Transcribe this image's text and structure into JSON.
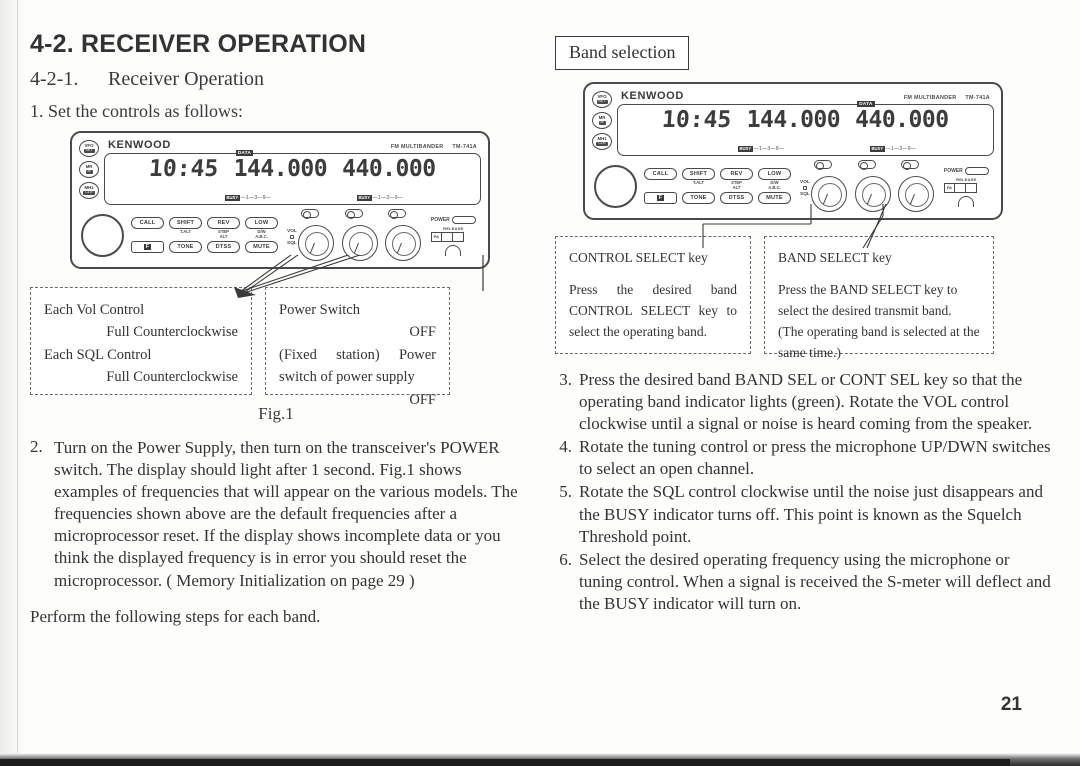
{
  "document": {
    "page_number": "21"
  },
  "left_column": {
    "section_title": "4-2. RECEIVER OPERATION",
    "subsection_number": "4-2-1.",
    "subsection_title": "Receiver Operation",
    "step1": "1. Set the controls as follows:",
    "figure_caption": "Fig.1",
    "callout_vol": {
      "line1": "Each Vol Control",
      "line2": "Full Counterclockwise",
      "line3": "Each SQL Control",
      "line4": "Full Counterclockwise"
    },
    "callout_power": {
      "line1": "Power Switch",
      "line2": "OFF",
      "line3": "(Fixed station) Power",
      "line4": "switch of power supply",
      "line5": "OFF"
    },
    "step2_number": "2.",
    "step2_text": "Turn on the Power Supply, then turn on the transceiver's POWER switch. The display should light after 1 second. Fig.1 shows examples of frequencies that will appear on the various models. The frequencies shown above are the default frequencies after a microprocessor reset.  If the display shows incomplete data or you think the displayed frequency is in error you should reset the microprocessor. ( Memory Initialization on page 29 )",
    "perform_text": "Perform the following steps for each band."
  },
  "right_column": {
    "band_selection_label": "Band selection",
    "callout_control_select": {
      "title": "CONTROL SELECT key",
      "body": "Press the desired band CONTROL SELECT key to select the operating band."
    },
    "callout_band_select": {
      "title": "BAND SELECT key",
      "body": "Press the BAND SELECT key to select the desired transmit band. (The operating band is selected at the same time.)"
    },
    "steps": [
      {
        "number": "3.",
        "text": "Press the desired band BAND SEL or CONT SEL key so that the operating band indicator lights (green). Rotate the VOL control clockwise until a signal or noise is heard coming from the speaker."
      },
      {
        "number": "4.",
        "text": "Rotate the tuning control or press the microphone UP/DWN switches to select an open channel."
      },
      {
        "number": "5.",
        "text": "Rotate the SQL control clockwise until the noise just disappears and the BUSY indicator turns off.  This point is known as the Squelch Threshold point."
      },
      {
        "number": "6.",
        "text": "Select the desired operating frequency using the microphone or tuning control.  When a signal is received the S-meter will deflect and the BUSY indicator will turn on."
      }
    ]
  },
  "radio": {
    "brand": "KENWOOD",
    "series": "FM MULTIBANDER",
    "model": "TM-741A",
    "side_buttons": [
      {
        "top": "VFO",
        "bottom": "SET"
      },
      {
        "top": "MR",
        "bottom": "M"
      },
      {
        "top": "MHz",
        "bottom": "CLR"
      }
    ],
    "display": {
      "clock": "10:45",
      "freq_a": "144.000",
      "freq_b": "440.000",
      "data_tag": "DATA",
      "smeter_tag": "BUSY",
      "smeter_scale": "—1—3—9—"
    },
    "keys_top": [
      "CALL",
      "SHIFT",
      "REV",
      "LOW"
    ],
    "keys_bottom": [
      "TONE",
      "DTSS",
      "MUTE"
    ],
    "sublabels_top": [
      "",
      "T.ALT",
      "STEP / ALT",
      "D/W / A.B.C."
    ],
    "vol_label": "VOL",
    "sql_label": "SQL",
    "power_label": "POWER",
    "release_label": "RELEASE",
    "release_first": "PA"
  },
  "colors": {
    "page_background": "#fdfdfc",
    "ink": "#2a2a2a",
    "line": "#4a4a4a",
    "dashed_border": "#6a6a6a"
  }
}
